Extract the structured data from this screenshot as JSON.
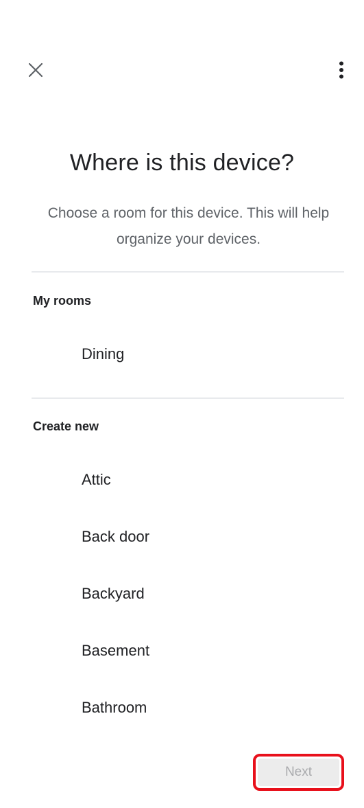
{
  "header": {
    "close_icon": "close-icon",
    "menu_icon": "more-vert-icon"
  },
  "main": {
    "title": "Where is this device?",
    "subtitle": "Choose a room for this device. This will help organize your devices."
  },
  "my_rooms": {
    "label": "My rooms",
    "items": [
      {
        "label": "Dining"
      }
    ]
  },
  "create_new": {
    "label": "Create new",
    "items": [
      {
        "label": "Attic"
      },
      {
        "label": "Back door"
      },
      {
        "label": "Backyard"
      },
      {
        "label": "Basement"
      },
      {
        "label": "Bathroom"
      }
    ]
  },
  "footer": {
    "next_label": "Next"
  },
  "colors": {
    "highlight_border": "#e8101b",
    "disabled_button_bg": "#ececec",
    "disabled_button_text": "#a9aaad"
  }
}
